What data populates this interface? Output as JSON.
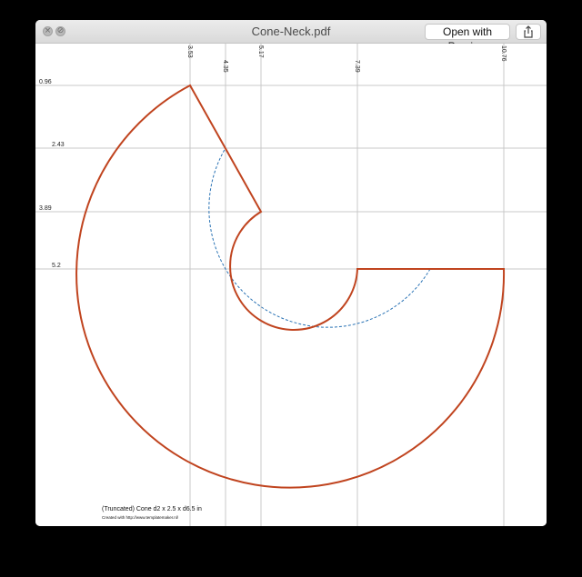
{
  "window": {
    "title": "Cone-Neck.pdf",
    "open_button_label": "Open with Preview",
    "close_icon": "close-icon",
    "minimize_icon": "minimize-icon",
    "share_icon": "share-icon"
  },
  "template": {
    "x_marks": [
      "3.53",
      "4.35",
      "5.17",
      "7.39",
      "10.76"
    ],
    "y_marks": [
      "0.96",
      "2.43",
      "3.89",
      "5.2"
    ],
    "caption": "(Truncated) Cone  d2 x 2.5 x d6.5 in",
    "credit": "Created with http://www.templatemaker.nl/",
    "colors": {
      "cut_line": "#c0441f",
      "fold_line": "#2a73b5",
      "guide_line": "#c8c8c8"
    }
  }
}
